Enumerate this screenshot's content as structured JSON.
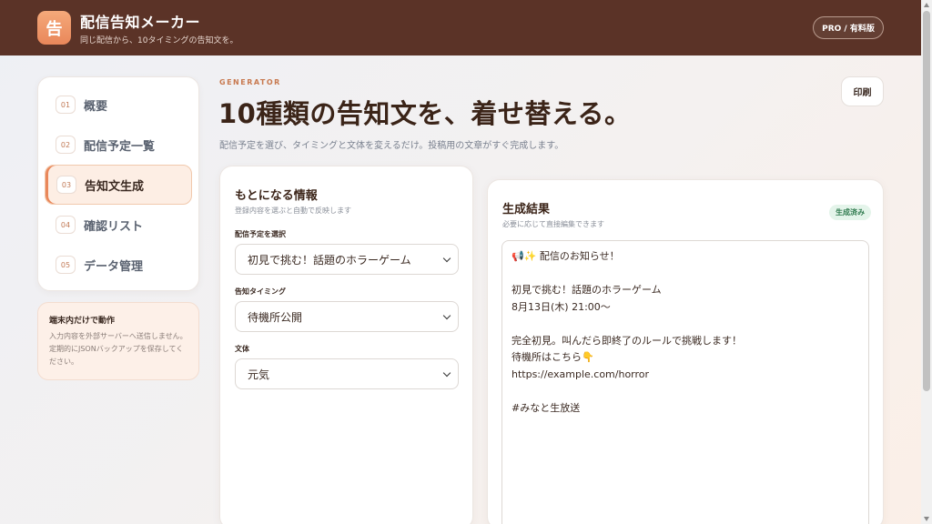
{
  "app": {
    "logo_char": "告",
    "title": "配信告知メーカー",
    "subtitle": "同じ配信から、10タイミングの告知文を。",
    "plan_badge": "PRO / 有料版"
  },
  "nav": [
    {
      "num": "01",
      "label": "概要"
    },
    {
      "num": "02",
      "label": "配信予定一覧"
    },
    {
      "num": "03",
      "label": "告知文生成",
      "active": true
    },
    {
      "num": "04",
      "label": "確認リスト"
    },
    {
      "num": "05",
      "label": "データ管理"
    }
  ],
  "local_card": {
    "title": "端末内だけで動作",
    "text": "入力内容を外部サーバーへ送信しません。定期的にJSONバックアップを保存してください。"
  },
  "main": {
    "eyebrow": "GENERATOR",
    "title": "10種類の告知文を、着せ替える。",
    "description": "配信予定を選び、タイミングと文体を変えるだけ。投稿用の文章がすぐ完成します。",
    "print_label": "印刷"
  },
  "source_panel": {
    "title": "もとになる情報",
    "subtitle": "登録内容を選ぶと自動で反映します",
    "fields": [
      {
        "label": "配信予定を選択",
        "value": "初見で挑む！話題のホラーゲーム"
      },
      {
        "label": "告知タイミング",
        "value": "待機所公開"
      },
      {
        "label": "文体",
        "value": "元気"
      }
    ]
  },
  "result_panel": {
    "title": "生成結果",
    "subtitle": "必要に応じて直接編集できます",
    "status": "生成済み",
    "text": "📢✨ 配信のお知らせ！\n\n初見で挑む！話題のホラーゲーム\n8月13日(木) 21:00〜\n\n完全初見。叫んだら即終了のルールで挑戦します！\n待機所はこちら👇\nhttps://example.com/horror\n\n#みなと生放送"
  },
  "colors": {
    "header_bg": "#5b3327",
    "accent": "#e9875a",
    "badge_green": "#2f7a4e"
  }
}
